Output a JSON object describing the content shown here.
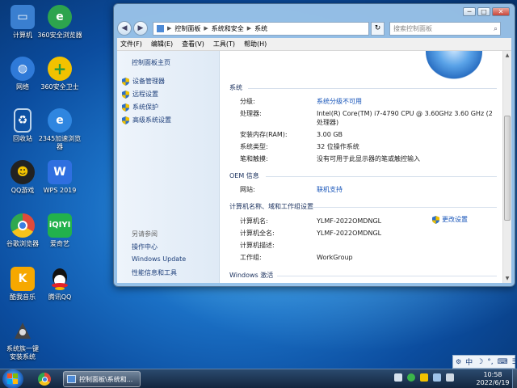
{
  "desktop": {
    "icons": [
      {
        "label": "计算机",
        "icon": "computer-icon",
        "color": "#3a7fd0"
      },
      {
        "label": "360安全浏览器",
        "icon": "browser-360-icon",
        "color": "#2da44e"
      },
      {
        "label": "网络",
        "icon": "network-icon",
        "color": "#2f7ad8"
      },
      {
        "label": "360安全卫士",
        "icon": "guard-360-icon",
        "color": "#3bb54a"
      },
      {
        "label": "回收站",
        "icon": "recycle-bin-icon",
        "color": "#8fb4d8"
      },
      {
        "label": "2345加速浏览器",
        "icon": "browser-2345-icon",
        "color": "#2f86e0"
      },
      {
        "label": "QQ游戏",
        "icon": "qq-game-icon",
        "color": "#f2c200"
      },
      {
        "label": "WPS 2019",
        "icon": "wps-icon",
        "color": "#2f6fe0"
      },
      {
        "label": "谷歌浏览器",
        "icon": "chrome-icon",
        "color": "#e04a3a"
      },
      {
        "label": "爱奇艺",
        "icon": "iqiyi-icon",
        "color": "#22b14c"
      },
      {
        "label": "酷我音乐",
        "icon": "kuwo-music-icon",
        "color": "#f6a800"
      },
      {
        "label": "腾讯QQ",
        "icon": "qq-icon",
        "color": "#222222"
      },
      {
        "label": "系统族一键安装系统",
        "icon": "installer-icon",
        "color": "#555555"
      }
    ]
  },
  "window": {
    "controls": {
      "minimize": "─",
      "maximize": "□",
      "close": "✕"
    },
    "breadcrumb": [
      "控制面板",
      "系统和安全",
      "系统"
    ],
    "search_placeholder": "搜索控制面板",
    "menu": [
      "文件(F)",
      "编辑(E)",
      "查看(V)",
      "工具(T)",
      "帮助(H)"
    ],
    "sidebar": {
      "home": "控制面板主页",
      "links": [
        "设备管理器",
        "远程设置",
        "系统保护",
        "高级系统设置"
      ],
      "see_also_title": "另请参阅",
      "see_also": [
        "操作中心",
        "Windows Update",
        "性能信息和工具"
      ]
    },
    "system": {
      "title": "系统",
      "rating_label": "分级:",
      "rating_value": "系统分级不可用",
      "cpu_label": "处理器:",
      "cpu_value": "Intel(R) Core(TM) i7-4790 CPU @ 3.60GHz   3.60 GHz  (2 处理器)",
      "ram_label": "安装内存(RAM):",
      "ram_value": "3.00 GB",
      "type_label": "系统类型:",
      "type_value": "32 位操作系统",
      "pen_label": "笔和触摸:",
      "pen_value": "没有可用于此显示器的笔或触控输入"
    },
    "oem": {
      "title": "OEM 信息",
      "web_label": "网站:",
      "web_value": "联机支持"
    },
    "computer": {
      "title": "计算机名称、域和工作组设置",
      "name_label": "计算机名:",
      "name_value": "YLMF-2022OMDNGL",
      "full_label": "计算机全名:",
      "full_value": "YLMF-2022OMDNGL",
      "desc_label": "计算机描述:",
      "desc_value": "",
      "wg_label": "工作组:",
      "wg_value": "WorkGroup",
      "change_settings": "更改设置"
    },
    "activation": {
      "title": "Windows 激活"
    }
  },
  "ime": {
    "items": [
      "中",
      "☽",
      "°,",
      "⌨",
      "☰"
    ]
  },
  "taskbar": {
    "task_label": "控制面板\\系统和...",
    "time": "10:58",
    "date": "2022/6/19"
  }
}
